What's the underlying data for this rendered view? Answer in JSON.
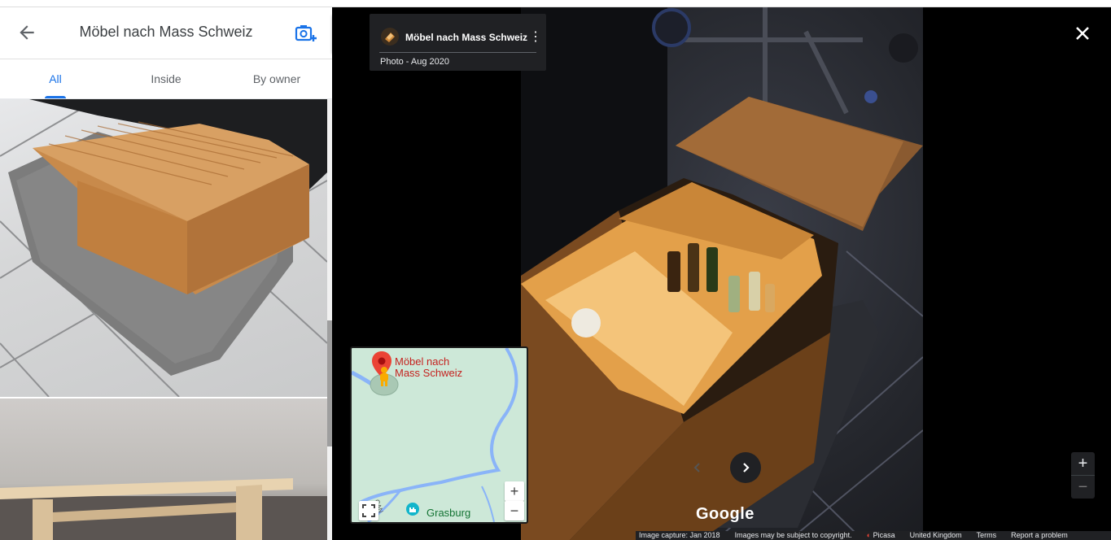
{
  "header": {
    "title": "Möbel nach Mass Schweiz",
    "back_icon": "arrow-back-icon",
    "add_photo_icon": "add-photo-icon"
  },
  "tabs": [
    {
      "label": "All",
      "active": true
    },
    {
      "label": "Inside",
      "active": false
    },
    {
      "label": "By owner",
      "active": false
    }
  ],
  "gallery": {
    "photos": [
      {
        "subject": "wooden-cube-table-photo"
      },
      {
        "subject": "wooden-bench-photo"
      }
    ]
  },
  "info_card": {
    "name": "Möbel nach Mass Schweiz",
    "meta": "Photo - Aug 2020"
  },
  "minimap": {
    "place_name_line1": "Möbel nach",
    "place_name_line2": "Mass Schweiz",
    "poi_name": "Grasburg",
    "road_label": "CAN",
    "zoom_in": "+",
    "zoom_out": "−"
  },
  "viewer": {
    "zoom_in": "+",
    "zoom_out": "−",
    "google_logo": "Google"
  },
  "footer": {
    "capture": "Image capture: Jan 2018",
    "copyright": "Images may be subject to copyright.",
    "source": "Picasa",
    "region": "United Kingdom",
    "terms": "Terms",
    "report": "Report a problem"
  },
  "colors": {
    "accent": "#1a73e8",
    "pin": "#ea4335",
    "map_bg": "#cde8d8",
    "water": "#8ab4f8",
    "card_bg": "#202124"
  }
}
